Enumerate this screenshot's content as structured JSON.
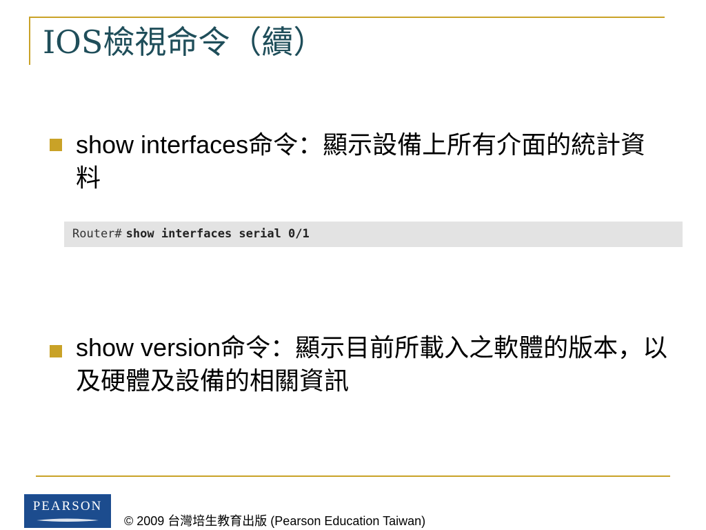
{
  "slide": {
    "title": "IOS檢視命令（續）",
    "bullets": [
      {
        "icon": "square-bullet-icon",
        "text": "show interfaces命令：顯示設備上所有介面的統計資料"
      },
      {
        "icon": "square-bullet-icon",
        "text": "show version命令：顯示目前所載入之軟體的版本，以及硬體及設備的相關資訊"
      }
    ],
    "code": {
      "prompt": "Router#",
      "command": "show interfaces serial 0/1"
    }
  },
  "footer": {
    "logo_text": "PEARSON",
    "copyright": "© 2009 台灣培生教育出版 (Pearson Education Taiwan)"
  },
  "colors": {
    "accent": "#c9a227",
    "title": "#1f4e5a",
    "code_bg": "#e3e3e3",
    "logo_bg": "#1c4c8e"
  }
}
